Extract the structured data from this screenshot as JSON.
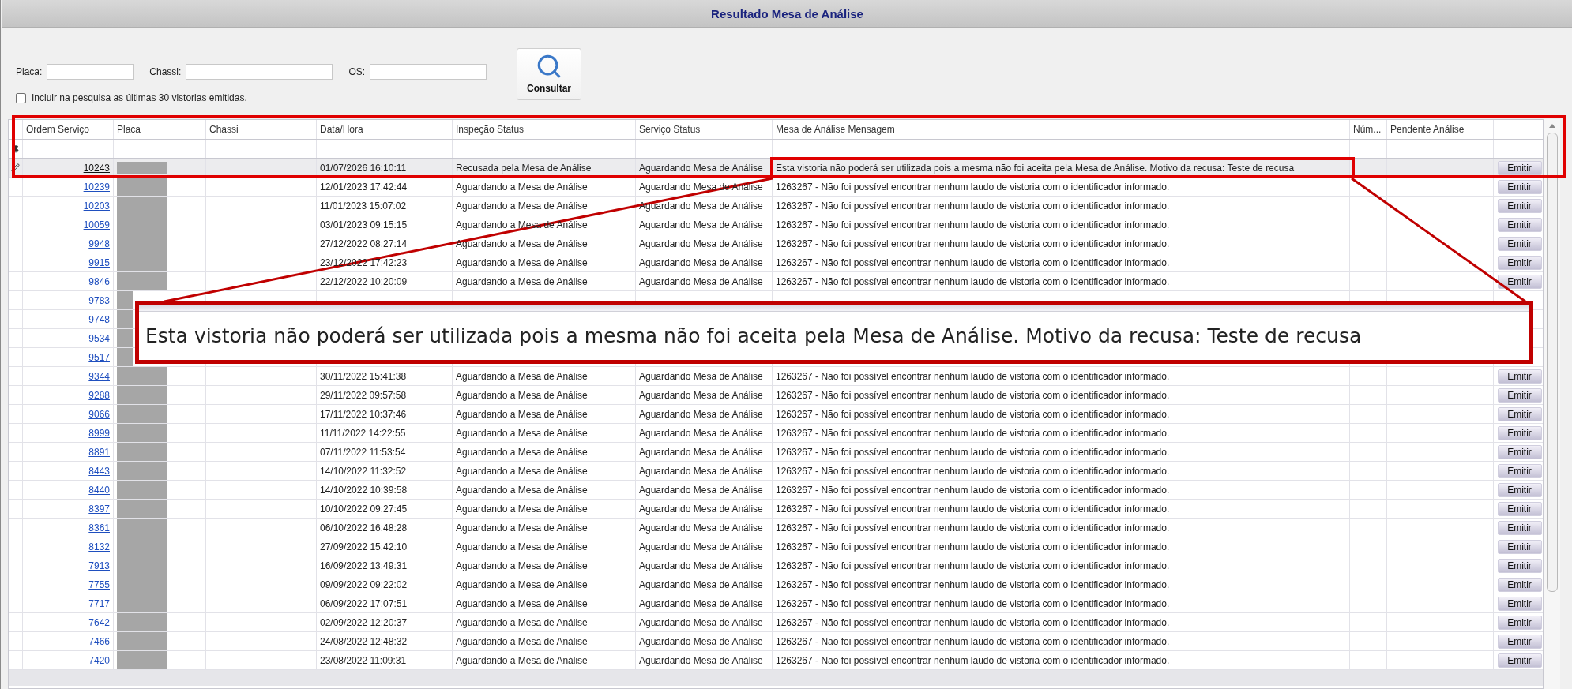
{
  "title": "Resultado Mesa de Análise",
  "filters": [
    {
      "label": "Placa:"
    },
    {
      "label": "Chassi:"
    },
    {
      "label": "OS:"
    }
  ],
  "search_button": "Consultar",
  "include_recent": {
    "label": "Incluir na pesquisa as últimas 30 vistorias emitidas.",
    "checked": false
  },
  "table": {
    "columns": [
      "Ordem Serviço",
      "Placa",
      "Chassi",
      "Data/Hora",
      "Inspeção Status",
      "Serviço Status",
      "Mesa de Análise Mensagem",
      "Núm...",
      "Pendente Análise"
    ],
    "rows": [
      {
        "ordem_servico": "10243",
        "data_hora": "01/07/2026 16:10:11",
        "inspecao_status": "Recusada pela Mesa de Análise",
        "servico_status": "Aguardando Mesa de Análise",
        "mensagem": "Esta vistoria não poderá ser utilizada pois a mesma não foi aceita pela Mesa de Análise. Motivo da recusa: Teste de recusa",
        "action": "Emitir",
        "selected": true
      },
      {
        "ordem_servico": "10239",
        "data_hora": "12/01/2023 17:42:44",
        "inspecao_status": "Aguardando a Mesa de Análise",
        "servico_status": "Aguardando Mesa de Análise",
        "mensagem": "1263267 - Não foi possível encontrar nenhum laudo de vistoria com o identificador informado.",
        "action": "Emitir",
        "selected": false
      },
      {
        "ordem_servico": "10203",
        "data_hora": "11/01/2023 15:07:02",
        "inspecao_status": "Aguardando a Mesa de Análise",
        "servico_status": "Aguardando Mesa de Análise",
        "mensagem": "1263267 - Não foi possível encontrar nenhum laudo de vistoria com o identificador informado.",
        "action": "Emitir",
        "selected": false
      },
      {
        "ordem_servico": "10059",
        "data_hora": "03/01/2023 09:15:15",
        "inspecao_status": "Aguardando a Mesa de Análise",
        "servico_status": "Aguardando Mesa de Análise",
        "mensagem": "1263267 - Não foi possível encontrar nenhum laudo de vistoria com o identificador informado.",
        "action": "Emitir",
        "selected": false
      },
      {
        "ordem_servico": "9948",
        "data_hora": "27/12/2022 08:27:14",
        "inspecao_status": "Aguardando a Mesa de Análise",
        "servico_status": "Aguardando Mesa de Análise",
        "mensagem": "1263267 - Não foi possível encontrar nenhum laudo de vistoria com o identificador informado.",
        "action": "Emitir",
        "selected": false
      },
      {
        "ordem_servico": "9915",
        "data_hora": "23/12/2022 17:42:23",
        "inspecao_status": "Aguardando a Mesa de Análise",
        "servico_status": "Aguardando Mesa de Análise",
        "mensagem": "1263267 - Não foi possível encontrar nenhum laudo de vistoria com o identificador informado.",
        "action": "Emitir",
        "selected": false
      },
      {
        "ordem_servico": "9846",
        "data_hora": "22/12/2022 10:20:09",
        "inspecao_status": "Aguardando a Mesa de Análise",
        "servico_status": "Aguardando Mesa de Análise",
        "mensagem": "1263267 - Não foi possível encontrar nenhum laudo de vistoria com o identificador informado.",
        "action": "Emitir",
        "selected": false
      },
      {
        "ordem_servico": "9783",
        "selected": false
      },
      {
        "ordem_servico": "9748",
        "selected": false
      },
      {
        "ordem_servico": "9534",
        "selected": false
      },
      {
        "ordem_servico": "9517",
        "selected": false
      },
      {
        "ordem_servico": "9344",
        "data_hora": "30/11/2022 15:41:38",
        "inspecao_status": "Aguardando a Mesa de Análise",
        "servico_status": "Aguardando Mesa de Análise",
        "mensagem": "1263267 - Não foi possível encontrar nenhum laudo de vistoria com o identificador informado.",
        "action": "Emitir",
        "selected": false
      },
      {
        "ordem_servico": "9288",
        "data_hora": "29/11/2022 09:57:58",
        "inspecao_status": "Aguardando a Mesa de Análise",
        "servico_status": "Aguardando Mesa de Análise",
        "mensagem": "1263267 - Não foi possível encontrar nenhum laudo de vistoria com o identificador informado.",
        "action": "Emitir",
        "selected": false
      },
      {
        "ordem_servico": "9066",
        "data_hora": "17/11/2022 10:37:46",
        "inspecao_status": "Aguardando a Mesa de Análise",
        "servico_status": "Aguardando Mesa de Análise",
        "mensagem": "1263267 - Não foi possível encontrar nenhum laudo de vistoria com o identificador informado.",
        "action": "Emitir",
        "selected": false
      },
      {
        "ordem_servico": "8999",
        "data_hora": "11/11/2022 14:22:55",
        "inspecao_status": "Aguardando a Mesa de Análise",
        "servico_status": "Aguardando Mesa de Análise",
        "mensagem": "1263267 - Não foi possível encontrar nenhum laudo de vistoria com o identificador informado.",
        "action": "Emitir",
        "selected": false
      },
      {
        "ordem_servico": "8891",
        "data_hora": "07/11/2022 11:53:54",
        "inspecao_status": "Aguardando a Mesa de Análise",
        "servico_status": "Aguardando Mesa de Análise",
        "mensagem": "1263267 - Não foi possível encontrar nenhum laudo de vistoria com o identificador informado.",
        "action": "Emitir",
        "selected": false
      },
      {
        "ordem_servico": "8443",
        "data_hora": "14/10/2022 11:32:52",
        "inspecao_status": "Aguardando a Mesa de Análise",
        "servico_status": "Aguardando Mesa de Análise",
        "mensagem": "1263267 - Não foi possível encontrar nenhum laudo de vistoria com o identificador informado.",
        "action": "Emitir",
        "selected": false
      },
      {
        "ordem_servico": "8440",
        "data_hora": "14/10/2022 10:39:58",
        "inspecao_status": "Aguardando a Mesa de Análise",
        "servico_status": "Aguardando Mesa de Análise",
        "mensagem": "1263267 - Não foi possível encontrar nenhum laudo de vistoria com o identificador informado.",
        "action": "Emitir",
        "selected": false
      },
      {
        "ordem_servico": "8397",
        "data_hora": "10/10/2022 09:27:45",
        "inspecao_status": "Aguardando a Mesa de Análise",
        "servico_status": "Aguardando Mesa de Análise",
        "mensagem": "1263267 - Não foi possível encontrar nenhum laudo de vistoria com o identificador informado.",
        "action": "Emitir",
        "selected": false
      },
      {
        "ordem_servico": "8361",
        "data_hora": "06/10/2022 16:48:28",
        "inspecao_status": "Aguardando a Mesa de Análise",
        "servico_status": "Aguardando Mesa de Análise",
        "mensagem": "1263267 - Não foi possível encontrar nenhum laudo de vistoria com o identificador informado.",
        "action": "Emitir",
        "selected": false
      },
      {
        "ordem_servico": "8132",
        "data_hora": "27/09/2022 15:42:10",
        "inspecao_status": "Aguardando a Mesa de Análise",
        "servico_status": "Aguardando Mesa de Análise",
        "mensagem": "1263267 - Não foi possível encontrar nenhum laudo de vistoria com o identificador informado.",
        "action": "Emitir",
        "selected": false
      },
      {
        "ordem_servico": "7913",
        "data_hora": "16/09/2022 13:49:31",
        "inspecao_status": "Aguardando a Mesa de Análise",
        "servico_status": "Aguardando Mesa de Análise",
        "mensagem": "1263267 - Não foi possível encontrar nenhum laudo de vistoria com o identificador informado.",
        "action": "Emitir",
        "selected": false
      },
      {
        "ordem_servico": "7755",
        "data_hora": "09/09/2022 09:22:02",
        "inspecao_status": "Aguardando a Mesa de Análise",
        "servico_status": "Aguardando Mesa de Análise",
        "mensagem": "1263267 - Não foi possível encontrar nenhum laudo de vistoria com o identificador informado.",
        "action": "Emitir",
        "selected": false
      },
      {
        "ordem_servico": "7717",
        "data_hora": "06/09/2022 17:07:51",
        "inspecao_status": "Aguardando a Mesa de Análise",
        "servico_status": "Aguardando Mesa de Análise",
        "mensagem": "1263267 - Não foi possível encontrar nenhum laudo de vistoria com o identificador informado.",
        "action": "Emitir",
        "selected": false
      },
      {
        "ordem_servico": "7642",
        "data_hora": "02/09/2022 12:20:37",
        "inspecao_status": "Aguardando a Mesa de Análise",
        "servico_status": "Aguardando Mesa de Análise",
        "mensagem": "1263267 - Não foi possível encontrar nenhum laudo de vistoria com o identificador informado.",
        "action": "Emitir",
        "selected": false
      },
      {
        "ordem_servico": "7466",
        "data_hora": "24/08/2022 12:48:32",
        "inspecao_status": "Aguardando a Mesa de Análise",
        "servico_status": "Aguardando Mesa de Análise",
        "mensagem": "1263267 - Não foi possível encontrar nenhum laudo de vistoria com o identificador informado.",
        "action": "Emitir",
        "selected": false
      },
      {
        "ordem_servico": "7420",
        "data_hora": "23/08/2022 11:09:31",
        "inspecao_status": "Aguardando a Mesa de Análise",
        "servico_status": "Aguardando Mesa de Análise",
        "mensagem": "1263267 - Não foi possível encontrar nenhum laudo de vistoria com o identificador informado.",
        "action": "Emitir",
        "selected": false
      }
    ]
  },
  "callout": {
    "text": "Esta vistoria não poderá ser utilizada pois a mesma não foi aceita pela Mesa de Análise. Motivo da recusa: Teste de recusa"
  }
}
